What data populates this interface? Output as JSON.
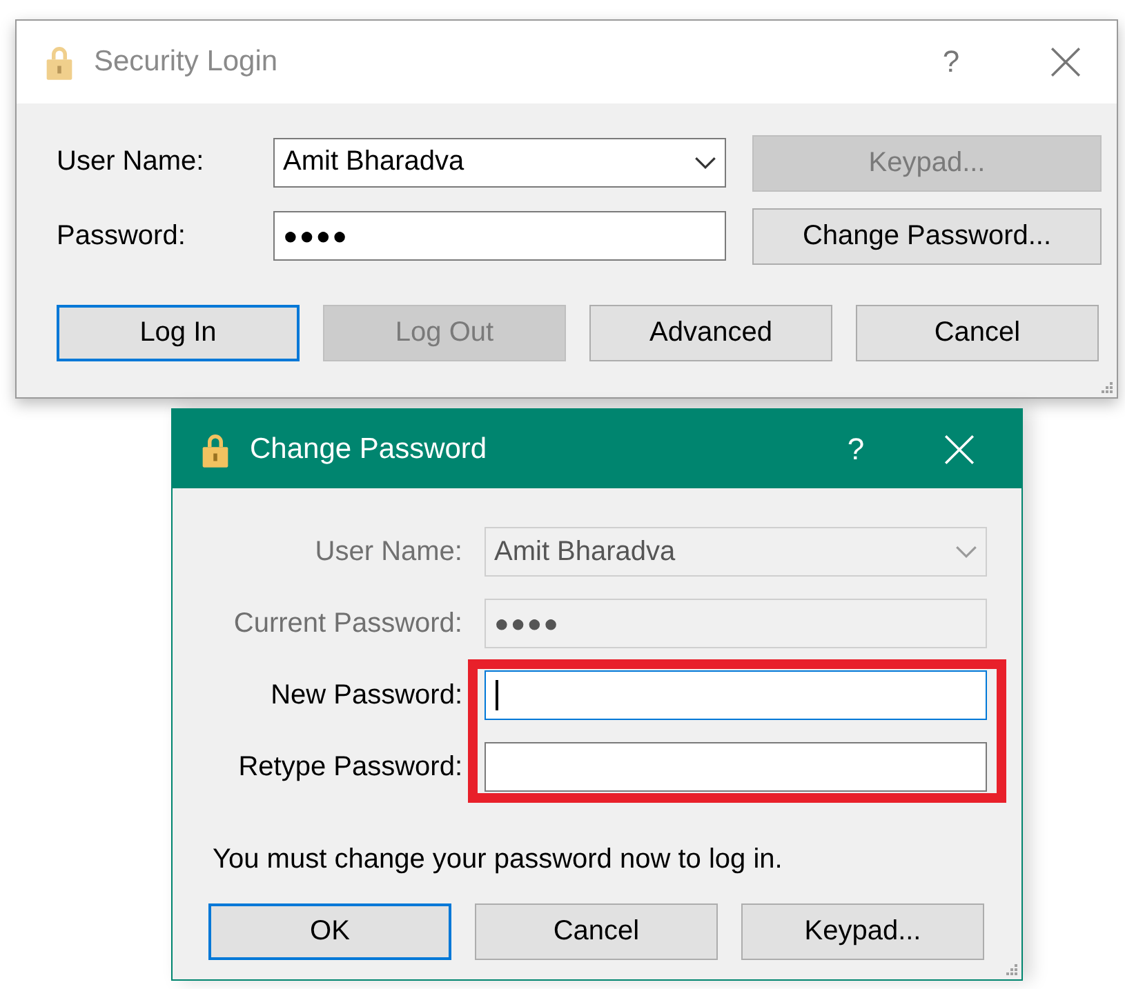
{
  "dialogs": [
    {
      "kind": "login",
      "title": "Security Login",
      "active": false,
      "help_label": "?",
      "fields": [
        {
          "label": "User Name:",
          "kind": "combo",
          "value": "Amit Bharadva",
          "disabled": false,
          "focused": false
        },
        {
          "label": "Password:",
          "kind": "password",
          "value": "●●●●",
          "disabled": false,
          "focused": false
        }
      ],
      "side_buttons": [
        {
          "label": "Keypad...",
          "default": false,
          "disabled": true
        },
        {
          "label": "Change Password...",
          "default": false,
          "disabled": false
        }
      ],
      "buttons": [
        {
          "label": "Log In",
          "default": true,
          "disabled": false
        },
        {
          "label": "Log Out",
          "default": false,
          "disabled": true
        },
        {
          "label": "Advanced",
          "default": false,
          "disabled": false
        },
        {
          "label": "Cancel",
          "default": false,
          "disabled": false
        }
      ]
    },
    {
      "kind": "change",
      "title": "Change Password",
      "active": true,
      "help_label": "?",
      "fields": [
        {
          "label": "User Name:",
          "kind": "combo",
          "value": "Amit Bharadva",
          "disabled": true,
          "focused": false,
          "highlighted": false
        },
        {
          "label": "Current Password:",
          "kind": "password",
          "value": "●●●●",
          "disabled": true,
          "focused": false,
          "highlighted": false
        },
        {
          "label": "New Password:",
          "kind": "password",
          "disabled": false,
          "focused": true,
          "highlighted": true
        },
        {
          "label": "Retype Password:",
          "kind": "password",
          "disabled": false,
          "focused": false,
          "highlighted": true
        }
      ],
      "message": "You must change your password now to log in.",
      "buttons": [
        {
          "label": "OK",
          "default": true,
          "disabled": false
        },
        {
          "label": "Cancel",
          "default": false,
          "disabled": false
        },
        {
          "label": "Keypad...",
          "default": false,
          "disabled": false
        }
      ]
    }
  ]
}
